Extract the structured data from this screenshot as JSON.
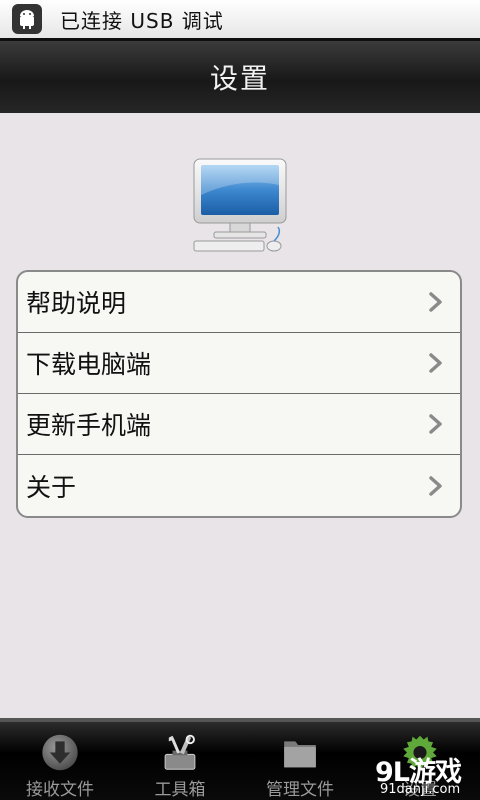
{
  "status_bar": {
    "text": "已连接 USB 调试",
    "icon": "android-debug-icon"
  },
  "header": {
    "title": "设置"
  },
  "hero": {
    "icon": "computer-monitor-icon"
  },
  "settings": {
    "items": [
      {
        "label": "帮助说明"
      },
      {
        "label": "下载电脑端"
      },
      {
        "label": "更新手机端"
      },
      {
        "label": "关于"
      }
    ]
  },
  "tabs": [
    {
      "label": "接收文件",
      "icon": "download-icon"
    },
    {
      "label": "工具箱",
      "icon": "toolbox-icon"
    },
    {
      "label": "管理文件",
      "icon": "folder-icon"
    },
    {
      "label": "设置",
      "icon": "settings-icon"
    }
  ],
  "watermark": {
    "brand": "9L游戏",
    "url": "91danji.com"
  },
  "colors": {
    "title_bar": "#1c1c1c",
    "background": "#e8e4e8",
    "list_bg": "#f7f7f3"
  }
}
